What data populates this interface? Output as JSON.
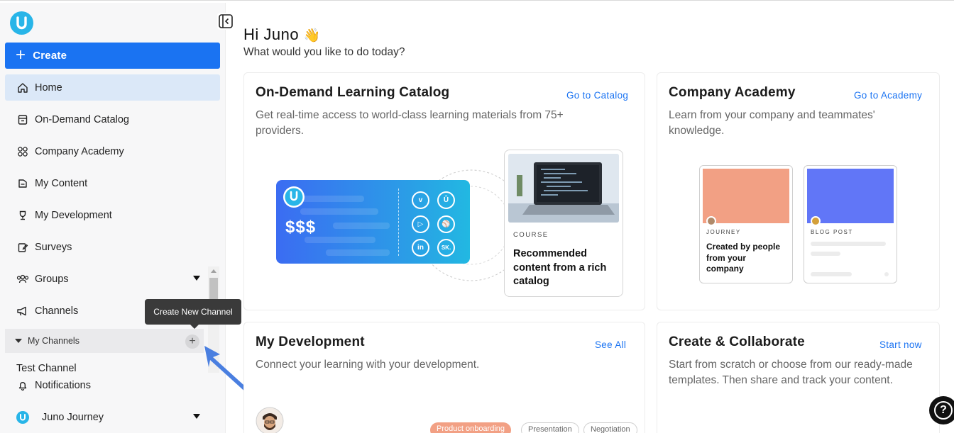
{
  "sidebar": {
    "create_label": "Create",
    "items": [
      {
        "label": "Home",
        "icon": "home-icon"
      },
      {
        "label": "On-Demand Catalog",
        "icon": "catalog-icon"
      },
      {
        "label": "Company Academy",
        "icon": "academy-icon"
      },
      {
        "label": "My Content",
        "icon": "content-icon"
      },
      {
        "label": "My Development",
        "icon": "trophy-icon"
      },
      {
        "label": "Surveys",
        "icon": "surveys-icon"
      },
      {
        "label": "Groups",
        "icon": "groups-icon"
      },
      {
        "label": "Channels",
        "icon": "megaphone-icon"
      }
    ],
    "my_channels_label": "My Channels",
    "add_channel_symbol": "+",
    "tooltip": "Create New Channel",
    "test_channel": "Test Channel",
    "notifications": "Notifications",
    "user_name": "Juno Journey"
  },
  "main": {
    "greeting": "Hi Juno",
    "greeting_emoji": "👋",
    "subtitle": "What would you like to do today?",
    "catalog": {
      "title": "On-Demand Learning Catalog",
      "link": "Go to Catalog",
      "description": "Get real-time access to world-class learning materials from 75+ providers.",
      "price_text": "$$$",
      "provider_badges": [
        "v",
        "Û",
        "▷",
        "⚾",
        "in",
        "SK."
      ],
      "course_tag": "COURSE",
      "course_text": "Recommended content from a rich catalog"
    },
    "academy": {
      "title": "Company Academy",
      "link": "Go to Academy",
      "description": "Learn from your company and teammates' knowledge.",
      "card1_tag": "JOURNEY",
      "card1_text": "Created by people from your company",
      "card2_tag": "BLOG POST"
    },
    "development": {
      "title": "My Development",
      "link": "See All",
      "description": "Connect your learning with your development.",
      "pills": [
        "Product onboarding",
        "Presentation",
        "Negotiation"
      ]
    },
    "collaborate": {
      "title": "Create & Collaborate",
      "link": "Start now",
      "description": "Start from scratch or choose from our ready-made templates. Then share and track your content."
    }
  },
  "colors": {
    "accent": "#1a73f2",
    "brand": "#28b5e8",
    "active_nav": "#dbe8f8",
    "journey_cover": "#f2a084",
    "blog_cover": "#6176f7"
  }
}
